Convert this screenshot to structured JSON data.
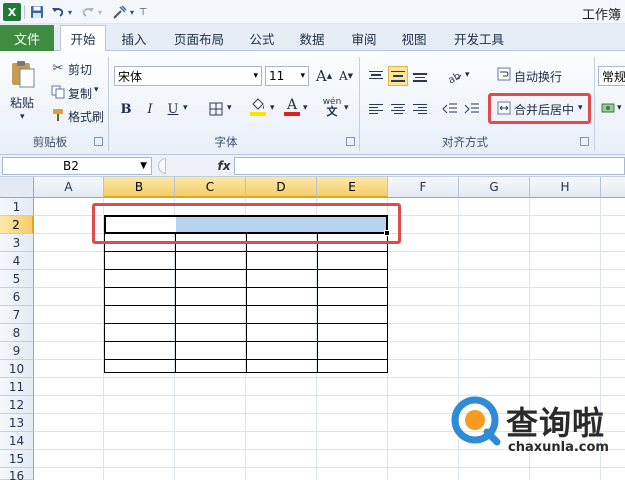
{
  "title_bar": {
    "app_title": "工作簿"
  },
  "tabs": [
    {
      "label": "文件"
    },
    {
      "label": "开始"
    },
    {
      "label": "插入"
    },
    {
      "label": "页面布局"
    },
    {
      "label": "公式"
    },
    {
      "label": "数据"
    },
    {
      "label": "审阅"
    },
    {
      "label": "视图"
    },
    {
      "label": "开发工具"
    }
  ],
  "ribbon": {
    "clipboard": {
      "paste": "粘贴",
      "cut": "剪切",
      "copy": "复制",
      "format_painter": "格式刷",
      "group_label": "剪贴板"
    },
    "font": {
      "font_name": "宋体",
      "font_size": "11",
      "bold": "B",
      "italic": "I",
      "underline": "U",
      "grow": "A",
      "shrink": "A",
      "font_color_letter": "A",
      "phonetic": "wén",
      "group_label": "字体"
    },
    "alignment": {
      "wrap_text": "自动换行",
      "merge_center": "合并后居中",
      "group_label": "对齐方式"
    },
    "number": {
      "format": "常规"
    }
  },
  "formula_bar": {
    "name_box": "B2",
    "fx": "fx",
    "value": ""
  },
  "grid": {
    "columns": [
      "A",
      "B",
      "C",
      "D",
      "E",
      "F",
      "G",
      "H"
    ],
    "rows": [
      "1",
      "2",
      "3",
      "4",
      "5",
      "6",
      "7",
      "8",
      "9",
      "10",
      "11",
      "12",
      "13",
      "14",
      "15",
      "16"
    ],
    "selected_columns": [
      "B",
      "C",
      "D",
      "E"
    ],
    "selected_row": "2"
  },
  "watermark": {
    "name": "查询啦",
    "url": "chaxunla.com"
  },
  "colors": {
    "file_tab": "#3f8b3f",
    "highlight_red": "#e14b4b",
    "selection_fill": "#b7d3ee",
    "header_selected": "#f5cd6a"
  }
}
